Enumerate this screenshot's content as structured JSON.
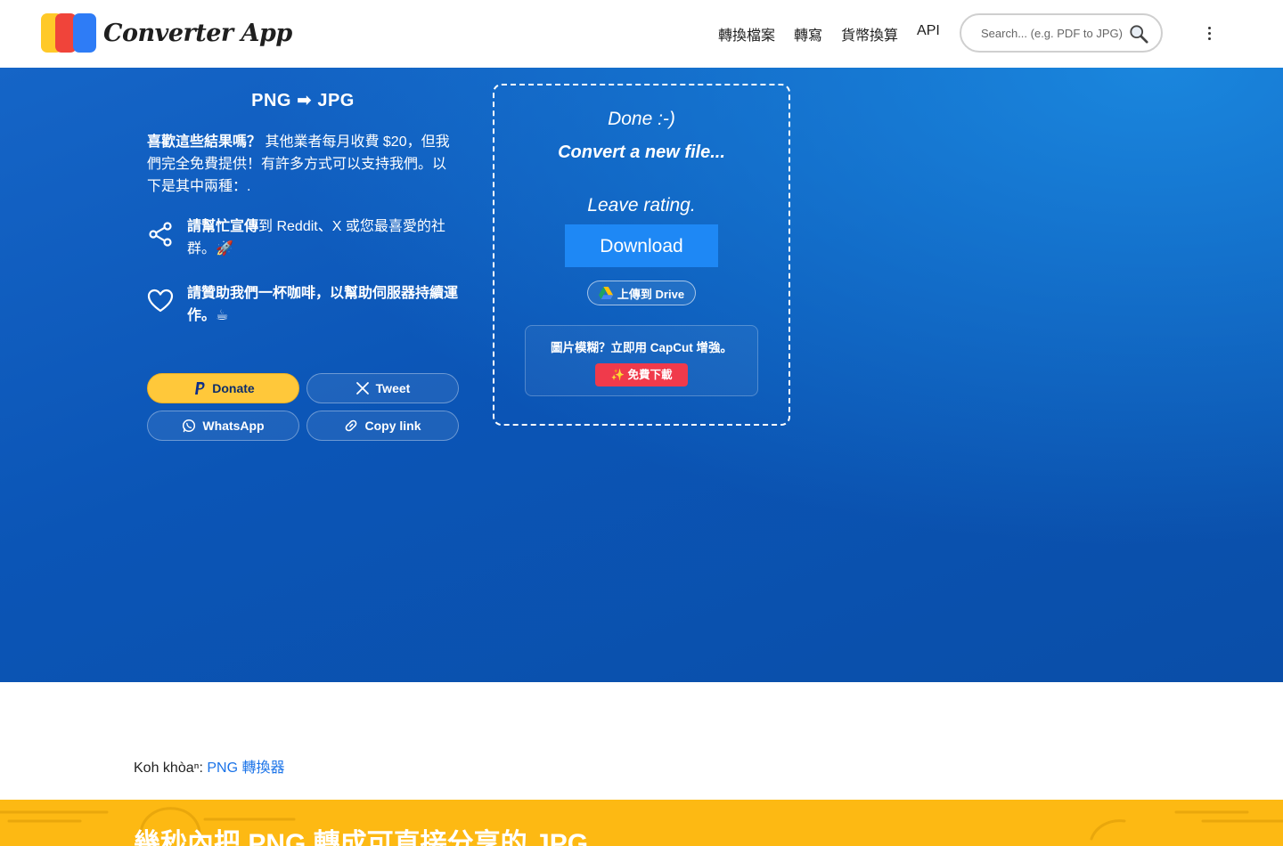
{
  "app": {
    "name": "Converter App"
  },
  "nav": {
    "items": [
      "轉換檔案",
      "轉寫",
      "貨幣換算",
      "API"
    ]
  },
  "search": {
    "placeholder": "Search... (e.g. PDF to JPG)"
  },
  "left_panel": {
    "title": "PNG ➡ JPG",
    "intro_bold": "喜歡這些結果嗎？",
    "intro_rest": " 其他業者每月收費 $20，但我們完全免費提供！有許多方式可以支持我們。以下是其中兩種：.",
    "share_bold": "請幫忙宣傳",
    "share_rest": "到 Reddit、X 或您最喜愛的社群。🚀",
    "coffee_text": "請贊助我們一杯咖啡，以幫助伺服器持續運作。☕",
    "buttons": {
      "donate": "Donate",
      "tweet": "Tweet",
      "whatsapp": "WhatsApp",
      "copy_link": "Copy link"
    }
  },
  "result": {
    "done": "Done :-)",
    "convert_new": "Convert a new file...",
    "rating": "Leave rating.",
    "download": "Download",
    "drive": "上傳到 Drive",
    "capcut_text": "圖片模糊？立即用 CapCut 增強。",
    "capcut_button": "✨ 免費下載"
  },
  "breadcrumb": {
    "prefix": "Koh khòaⁿ: ",
    "link": "PNG 轉換器"
  },
  "band": {
    "title": "幾秒內把 PNG 轉成可直接分享的 JPG"
  },
  "colors": {
    "hero": "#0b55b6",
    "download": "#1E88F5",
    "donate": "#FFC83A",
    "band": "#FDB913",
    "capcut": "#F03A4B"
  }
}
